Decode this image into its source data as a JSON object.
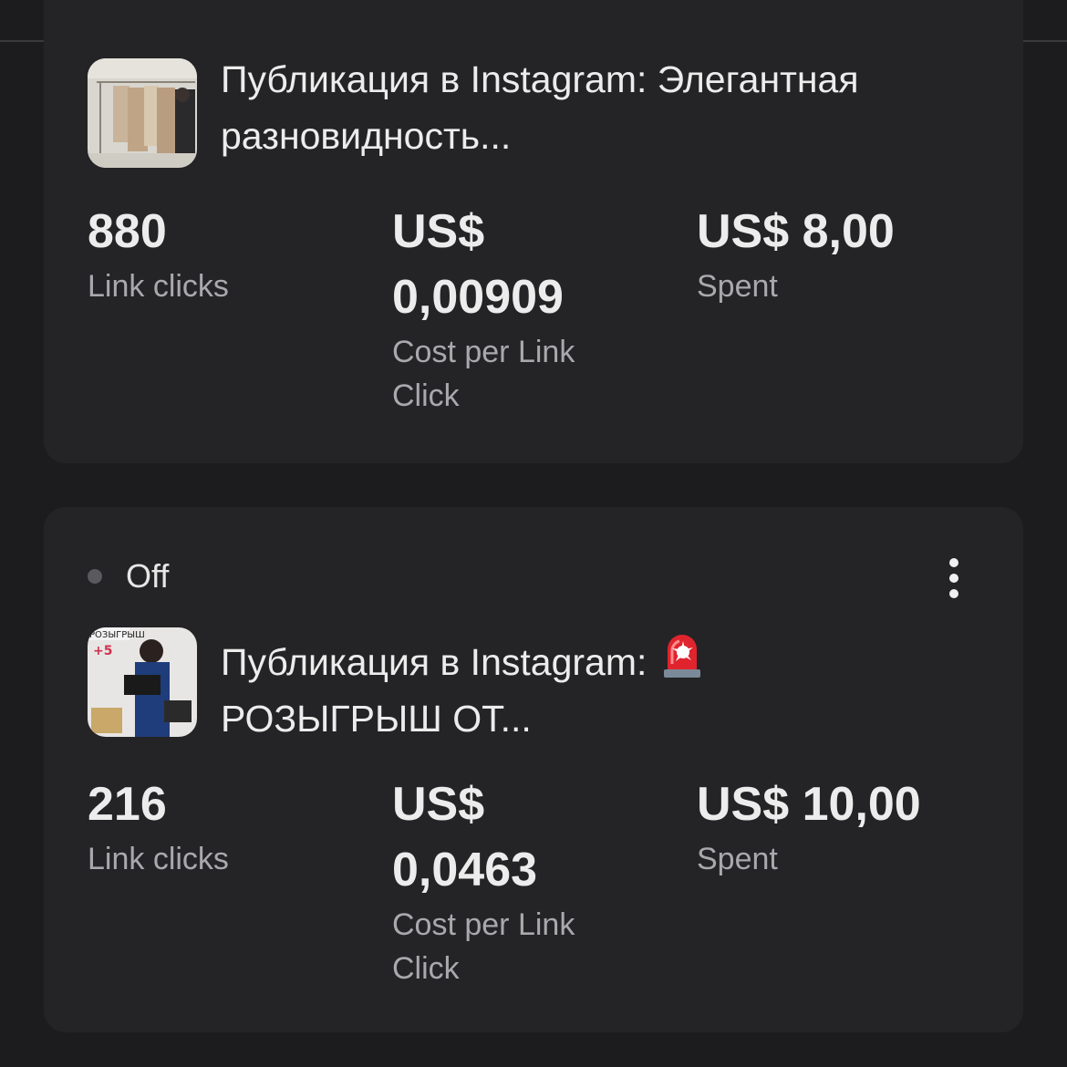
{
  "ads": [
    {
      "title": "Публикация в Instagram: Элегантная разновидность...",
      "metrics": {
        "link_clicks_value": "880",
        "link_clicks_label": "Link clicks",
        "cpc_currency": "US$",
        "cpc_value": "0,00909",
        "cpc_label_line1": "Cost per Link",
        "cpc_label_line2": "Click",
        "spent_value": "US$ 8,00",
        "spent_label": "Spent"
      }
    },
    {
      "status": "Off",
      "title_line1": "Публикация в Instagram:",
      "title_line2": "РОЗЫГРЫШ ОТ...",
      "title_emoji": "siren-icon",
      "metrics": {
        "link_clicks_value": "216",
        "link_clicks_label": "Link clicks",
        "cpc_currency": "US$",
        "cpc_value": "0,0463",
        "cpc_label_line1": "Cost per Link",
        "cpc_label_line2": "Click",
        "spent_value": "US$ 10,00",
        "spent_label": "Spent"
      }
    }
  ],
  "colors": {
    "background": "#1c1c1e",
    "card": "#242426",
    "primary_text": "#ececec",
    "secondary_text": "#a9a9ad",
    "status_dot_off": "#5a5a5e"
  }
}
